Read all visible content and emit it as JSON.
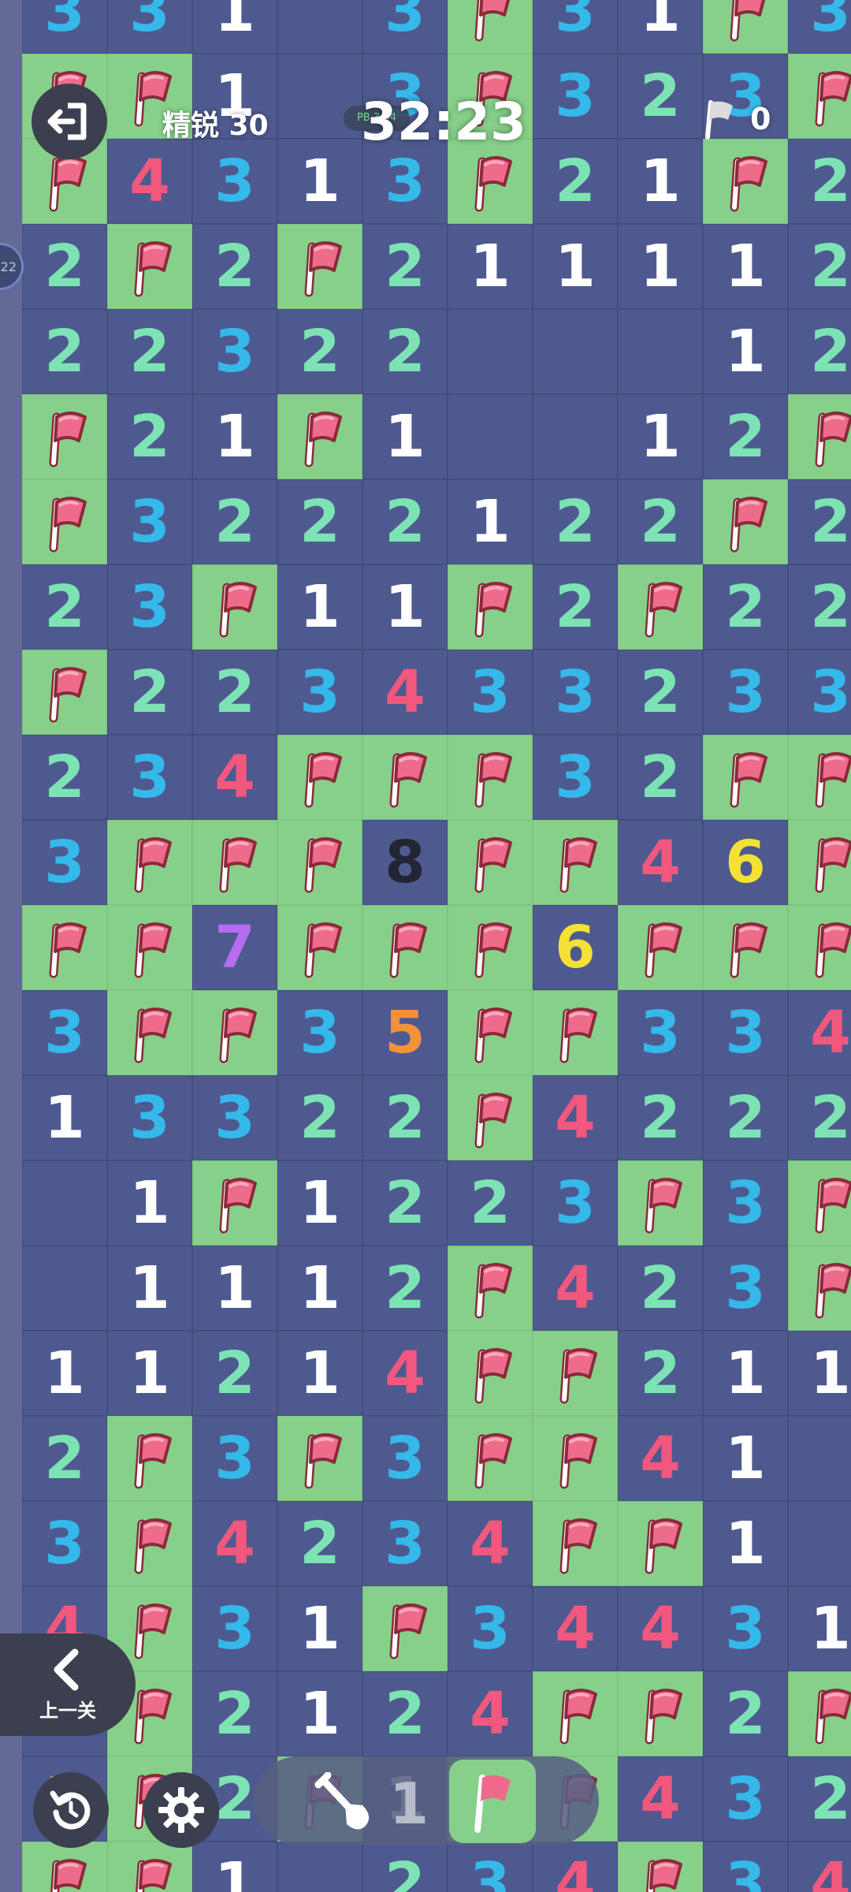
{
  "header": {
    "level_label": "精锐 30",
    "timer": "32:23",
    "best_badge_text": "PB 3:54",
    "flag_count": "0"
  },
  "side_badge_text": "22",
  "buttons": {
    "prev_level_label": "上一关"
  },
  "tools": {
    "dig_count": "1"
  },
  "number_colors": {
    "1": "#ffffff",
    "2": "#7de3b4",
    "3": "#35b8ea",
    "4": "#f2577e",
    "5": "#f2923a",
    "6": "#f3e233",
    "7": "#b56cf0",
    "8": "#222533"
  },
  "board": {
    "rows": [
      [
        "3",
        "3",
        "1",
        "",
        "3",
        "F",
        "3",
        "1",
        "F",
        "3"
      ],
      [
        "F",
        "F",
        "1",
        "",
        "3",
        "F",
        "3",
        "2",
        "3",
        "F"
      ],
      [
        "F",
        "4",
        "3",
        "1",
        "3",
        "F",
        "2",
        "1",
        "F",
        "2"
      ],
      [
        "2",
        "F",
        "2",
        "F",
        "2",
        "1",
        "1",
        "1",
        "1",
        "2"
      ],
      [
        "2",
        "2",
        "3",
        "2",
        "2",
        "",
        "",
        "",
        "1",
        "2"
      ],
      [
        "F",
        "2",
        "1",
        "F",
        "1",
        "",
        "",
        "1",
        "2",
        "F"
      ],
      [
        "F",
        "3",
        "2",
        "2",
        "2",
        "1",
        "2",
        "2",
        "F",
        "2"
      ],
      [
        "2",
        "3",
        "F",
        "1",
        "1",
        "F",
        "2",
        "F",
        "2",
        "2"
      ],
      [
        "F",
        "2",
        "2",
        "3",
        "4",
        "3",
        "3",
        "2",
        "3",
        "3"
      ],
      [
        "2",
        "3",
        "4",
        "F",
        "F",
        "F",
        "3",
        "2",
        "F",
        "F"
      ],
      [
        "3",
        "F",
        "F",
        "F",
        "8",
        "F",
        "F",
        "4",
        "6",
        "F"
      ],
      [
        "F",
        "F",
        "7",
        "F",
        "F",
        "F",
        "6",
        "F",
        "F",
        "F"
      ],
      [
        "3",
        "F",
        "F",
        "3",
        "5",
        "F",
        "F",
        "3",
        "3",
        "4"
      ],
      [
        "1",
        "3",
        "3",
        "2",
        "2",
        "F",
        "4",
        "2",
        "2",
        "2"
      ],
      [
        "",
        "1",
        "F",
        "1",
        "2",
        "2",
        "3",
        "F",
        "3",
        "F"
      ],
      [
        "",
        "1",
        "1",
        "1",
        "2",
        "F",
        "4",
        "2",
        "3",
        "F"
      ],
      [
        "1",
        "1",
        "2",
        "1",
        "4",
        "F",
        "F",
        "2",
        "1",
        "1"
      ],
      [
        "2",
        "F",
        "3",
        "F",
        "3",
        "F",
        "F",
        "4",
        "1",
        ""
      ],
      [
        "3",
        "F",
        "4",
        "2",
        "3",
        "4",
        "F",
        "F",
        "1",
        ""
      ],
      [
        "4",
        "F",
        "3",
        "1",
        "F",
        "3",
        "4",
        "4",
        "3",
        "1"
      ],
      [
        "3",
        "F",
        "2",
        "1",
        "2",
        "4",
        "F",
        "F",
        "2",
        "F"
      ],
      [
        "5",
        "F",
        "2",
        "F",
        "1",
        "F",
        "F",
        "4",
        "3",
        "2"
      ],
      [
        "F",
        "F",
        "1",
        "",
        "2",
        "3",
        "4",
        "F",
        "3",
        "4"
      ]
    ]
  }
}
